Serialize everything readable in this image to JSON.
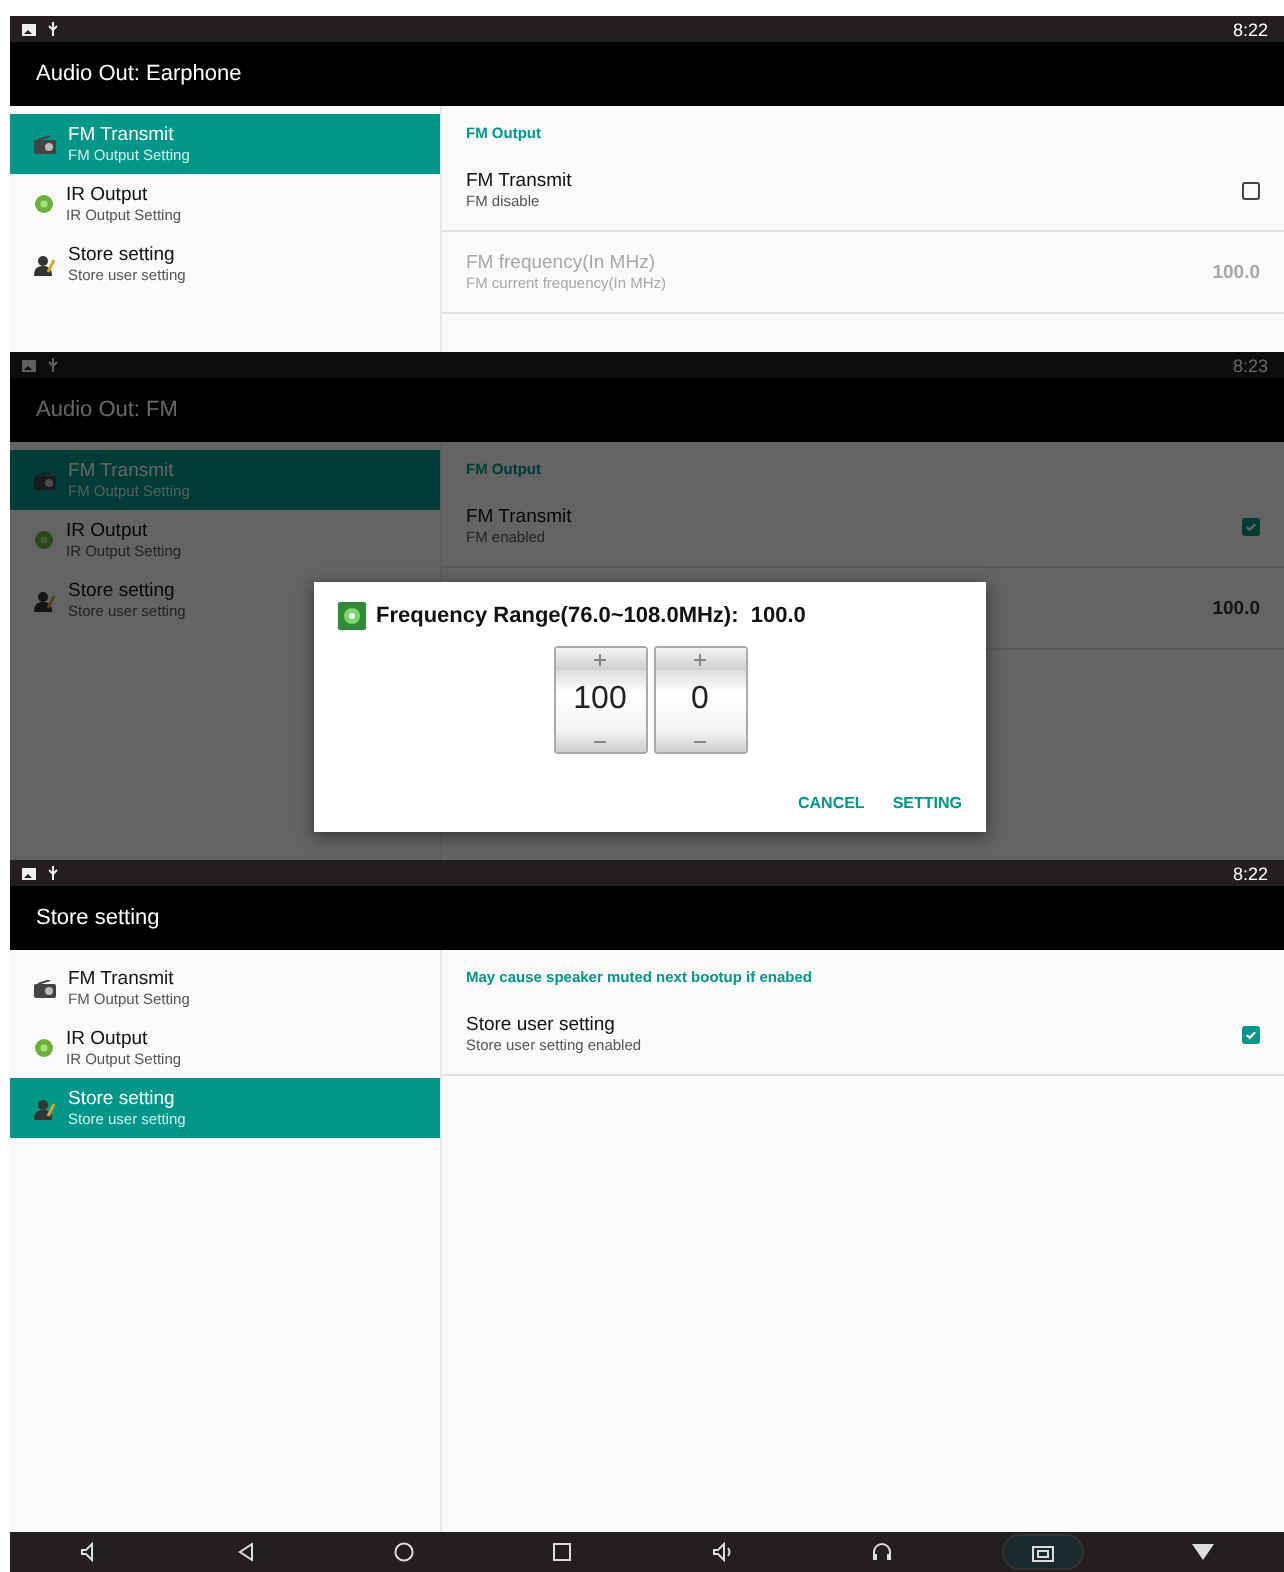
{
  "screens": [
    {
      "status_bar": {
        "time": "8:22"
      },
      "title": "Audio Out: Earphone",
      "dimmed": false,
      "sidebar": [
        {
          "kind": "radio",
          "title": "FM Transmit",
          "subtitle": "FM Output Setting",
          "selected": true
        },
        {
          "kind": "ir",
          "title": "IR Output",
          "subtitle": "IR Output Setting",
          "selected": false
        },
        {
          "kind": "user",
          "title": "Store setting",
          "subtitle": "Store user setting",
          "selected": false
        }
      ],
      "preferences": [
        {
          "kind": "category",
          "title": "FM Output"
        },
        {
          "kind": "checkbox",
          "title": "FM Transmit",
          "summary": "FM disable",
          "checked": false
        },
        {
          "kind": "value",
          "title": "FM frequency(In MHz)",
          "summary": "FM current frequency(In MHz)",
          "value": "100.0",
          "disabled": true
        }
      ]
    },
    {
      "status_bar": {
        "time": "8:23"
      },
      "title": "Audio Out: FM",
      "dimmed": true,
      "sidebar": [
        {
          "kind": "radio",
          "title": "FM Transmit",
          "subtitle": "FM Output Setting",
          "selected": true
        },
        {
          "kind": "ir",
          "title": "IR Output",
          "subtitle": "IR Output Setting",
          "selected": false
        },
        {
          "kind": "user",
          "title": "Store setting",
          "subtitle": "Store user setting",
          "selected": false
        }
      ],
      "preferences": [
        {
          "kind": "category",
          "title": "FM Output"
        },
        {
          "kind": "checkbox",
          "title": "FM Transmit",
          "summary": "FM enabled",
          "checked": true
        },
        {
          "kind": "value",
          "value": "100.0",
          "disabled": false
        }
      ],
      "dialog": {
        "title": "Frequency Range(76.0~108.0MHz):  100.0",
        "pickers": [
          "100",
          "0"
        ],
        "buttons": [
          "CANCEL",
          "SETTING"
        ]
      }
    },
    {
      "status_bar": {
        "time": "8:22"
      },
      "title": "Store setting",
      "dimmed": false,
      "sidebar": [
        {
          "kind": "radio",
          "title": "FM Transmit",
          "subtitle": "FM Output Setting",
          "selected": false
        },
        {
          "kind": "ir",
          "title": "IR Output",
          "subtitle": "IR Output Setting",
          "selected": false
        },
        {
          "kind": "user",
          "title": "Store setting",
          "subtitle": "Store user setting",
          "selected": true
        }
      ],
      "preferences": [
        {
          "kind": "category",
          "title": "May cause speaker muted next bootup if enabed"
        },
        {
          "kind": "checkbox",
          "title": "Store user setting",
          "summary": "Store user setting enabled",
          "checked": true
        }
      ]
    }
  ],
  "nav_bar": [
    {
      "kind": "volume-down",
      "selected": false
    },
    {
      "kind": "back",
      "selected": false
    },
    {
      "kind": "home",
      "selected": false
    },
    {
      "kind": "recents",
      "selected": false
    },
    {
      "kind": "volume-up",
      "selected": false
    },
    {
      "kind": "headphones",
      "selected": false
    },
    {
      "kind": "screenshot",
      "selected": true
    },
    {
      "kind": "menu",
      "selected": false
    }
  ]
}
